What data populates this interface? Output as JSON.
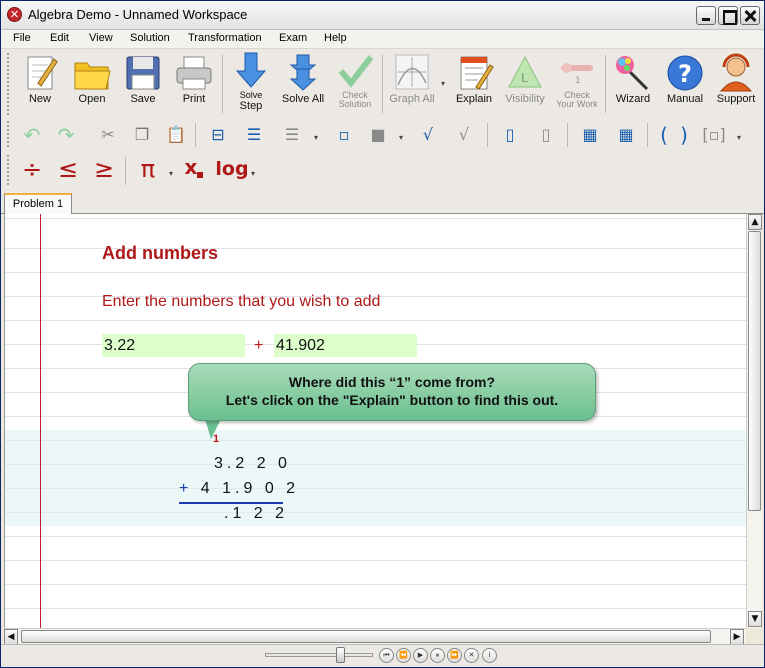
{
  "window": {
    "title": "Algebra Demo - Unnamed Workspace"
  },
  "menu": [
    "File",
    "Edit",
    "View",
    "Solution",
    "Transformation",
    "Exam",
    "Help"
  ],
  "toolbar": {
    "new": "New",
    "open": "Open",
    "save": "Save",
    "print": "Print",
    "solve_step_1": "Solve",
    "solve_step_2": "Step",
    "solve_all": "Solve All",
    "check_solution_1": "Check",
    "check_solution_2": "Solution",
    "graph_all": "Graph All",
    "explain": "Explain",
    "visibility": "Visibility",
    "check_work_1": "Check",
    "check_work_2": "Your Work",
    "wizard": "Wizard",
    "manual": "Manual",
    "support": "Support"
  },
  "math_toolbar": {
    "divide": "÷",
    "leq": "≤",
    "geq": "≥",
    "pi": "π",
    "subscript": "x",
    "log": "log"
  },
  "tabs": [
    "Problem 1"
  ],
  "problem": {
    "title": "Add numbers",
    "instruction": "Enter the numbers that you wish to add",
    "operand1": "3.22",
    "operator": "+",
    "operand2": "41.902"
  },
  "callout": {
    "line1": "Where did this “1” come from?",
    "line2": "Let's click on the \"Explain\" button to find this out."
  },
  "work": {
    "carry": "1",
    "row1": "3.2 2 0",
    "row2_op": "+",
    "row2": "4 1.9 0 2",
    "result": ".1 2 2"
  },
  "colors": {
    "accent_red": "#b01818",
    "input_green": "#ddffcc",
    "callout_green": "#6cbf90",
    "work_blue": "#1a3ab0"
  }
}
